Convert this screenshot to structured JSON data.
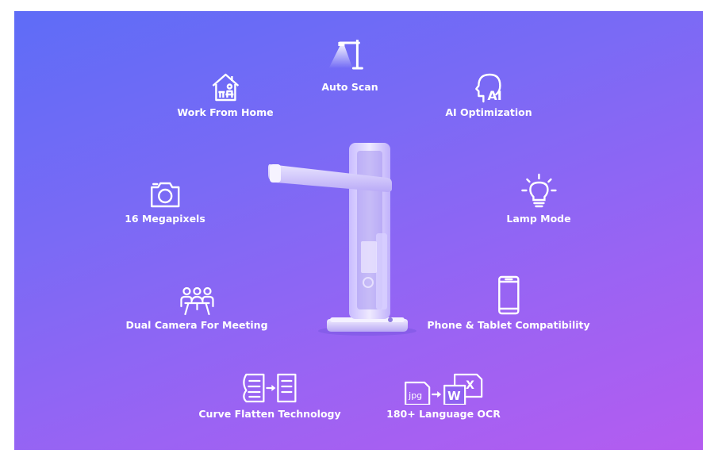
{
  "features": {
    "auto_scan": {
      "label": "Auto Scan",
      "icon": "desk-lamp-scan-icon"
    },
    "work_from_home": {
      "label": "Work From Home",
      "icon": "home-desk-icon"
    },
    "ai_optimization": {
      "label": "AI Optimization",
      "icon": "ai-head-icon"
    },
    "megapixels": {
      "label": "16 Megapixels",
      "icon": "camera-icon"
    },
    "lamp_mode": {
      "label": "Lamp Mode",
      "icon": "light-bulb-icon"
    },
    "dual_camera": {
      "label": "Dual Camera For Meeting",
      "icon": "meeting-people-icon"
    },
    "phone_tablet": {
      "label": "Phone & Tablet Compatibility",
      "icon": "phone-icon"
    },
    "curve_flatten": {
      "label": "Curve Flatten Technology",
      "icon": "document-flatten-icon"
    },
    "ocr": {
      "label": "180+ Language OCR",
      "icon": "jpg-to-word-icon",
      "jpg_text": "jpg",
      "w_text": "W",
      "x_text": "X"
    }
  },
  "colors": {
    "gradient_start": "#5e6cf7",
    "gradient_end": "#b45cf0",
    "text": "#ffffff"
  }
}
